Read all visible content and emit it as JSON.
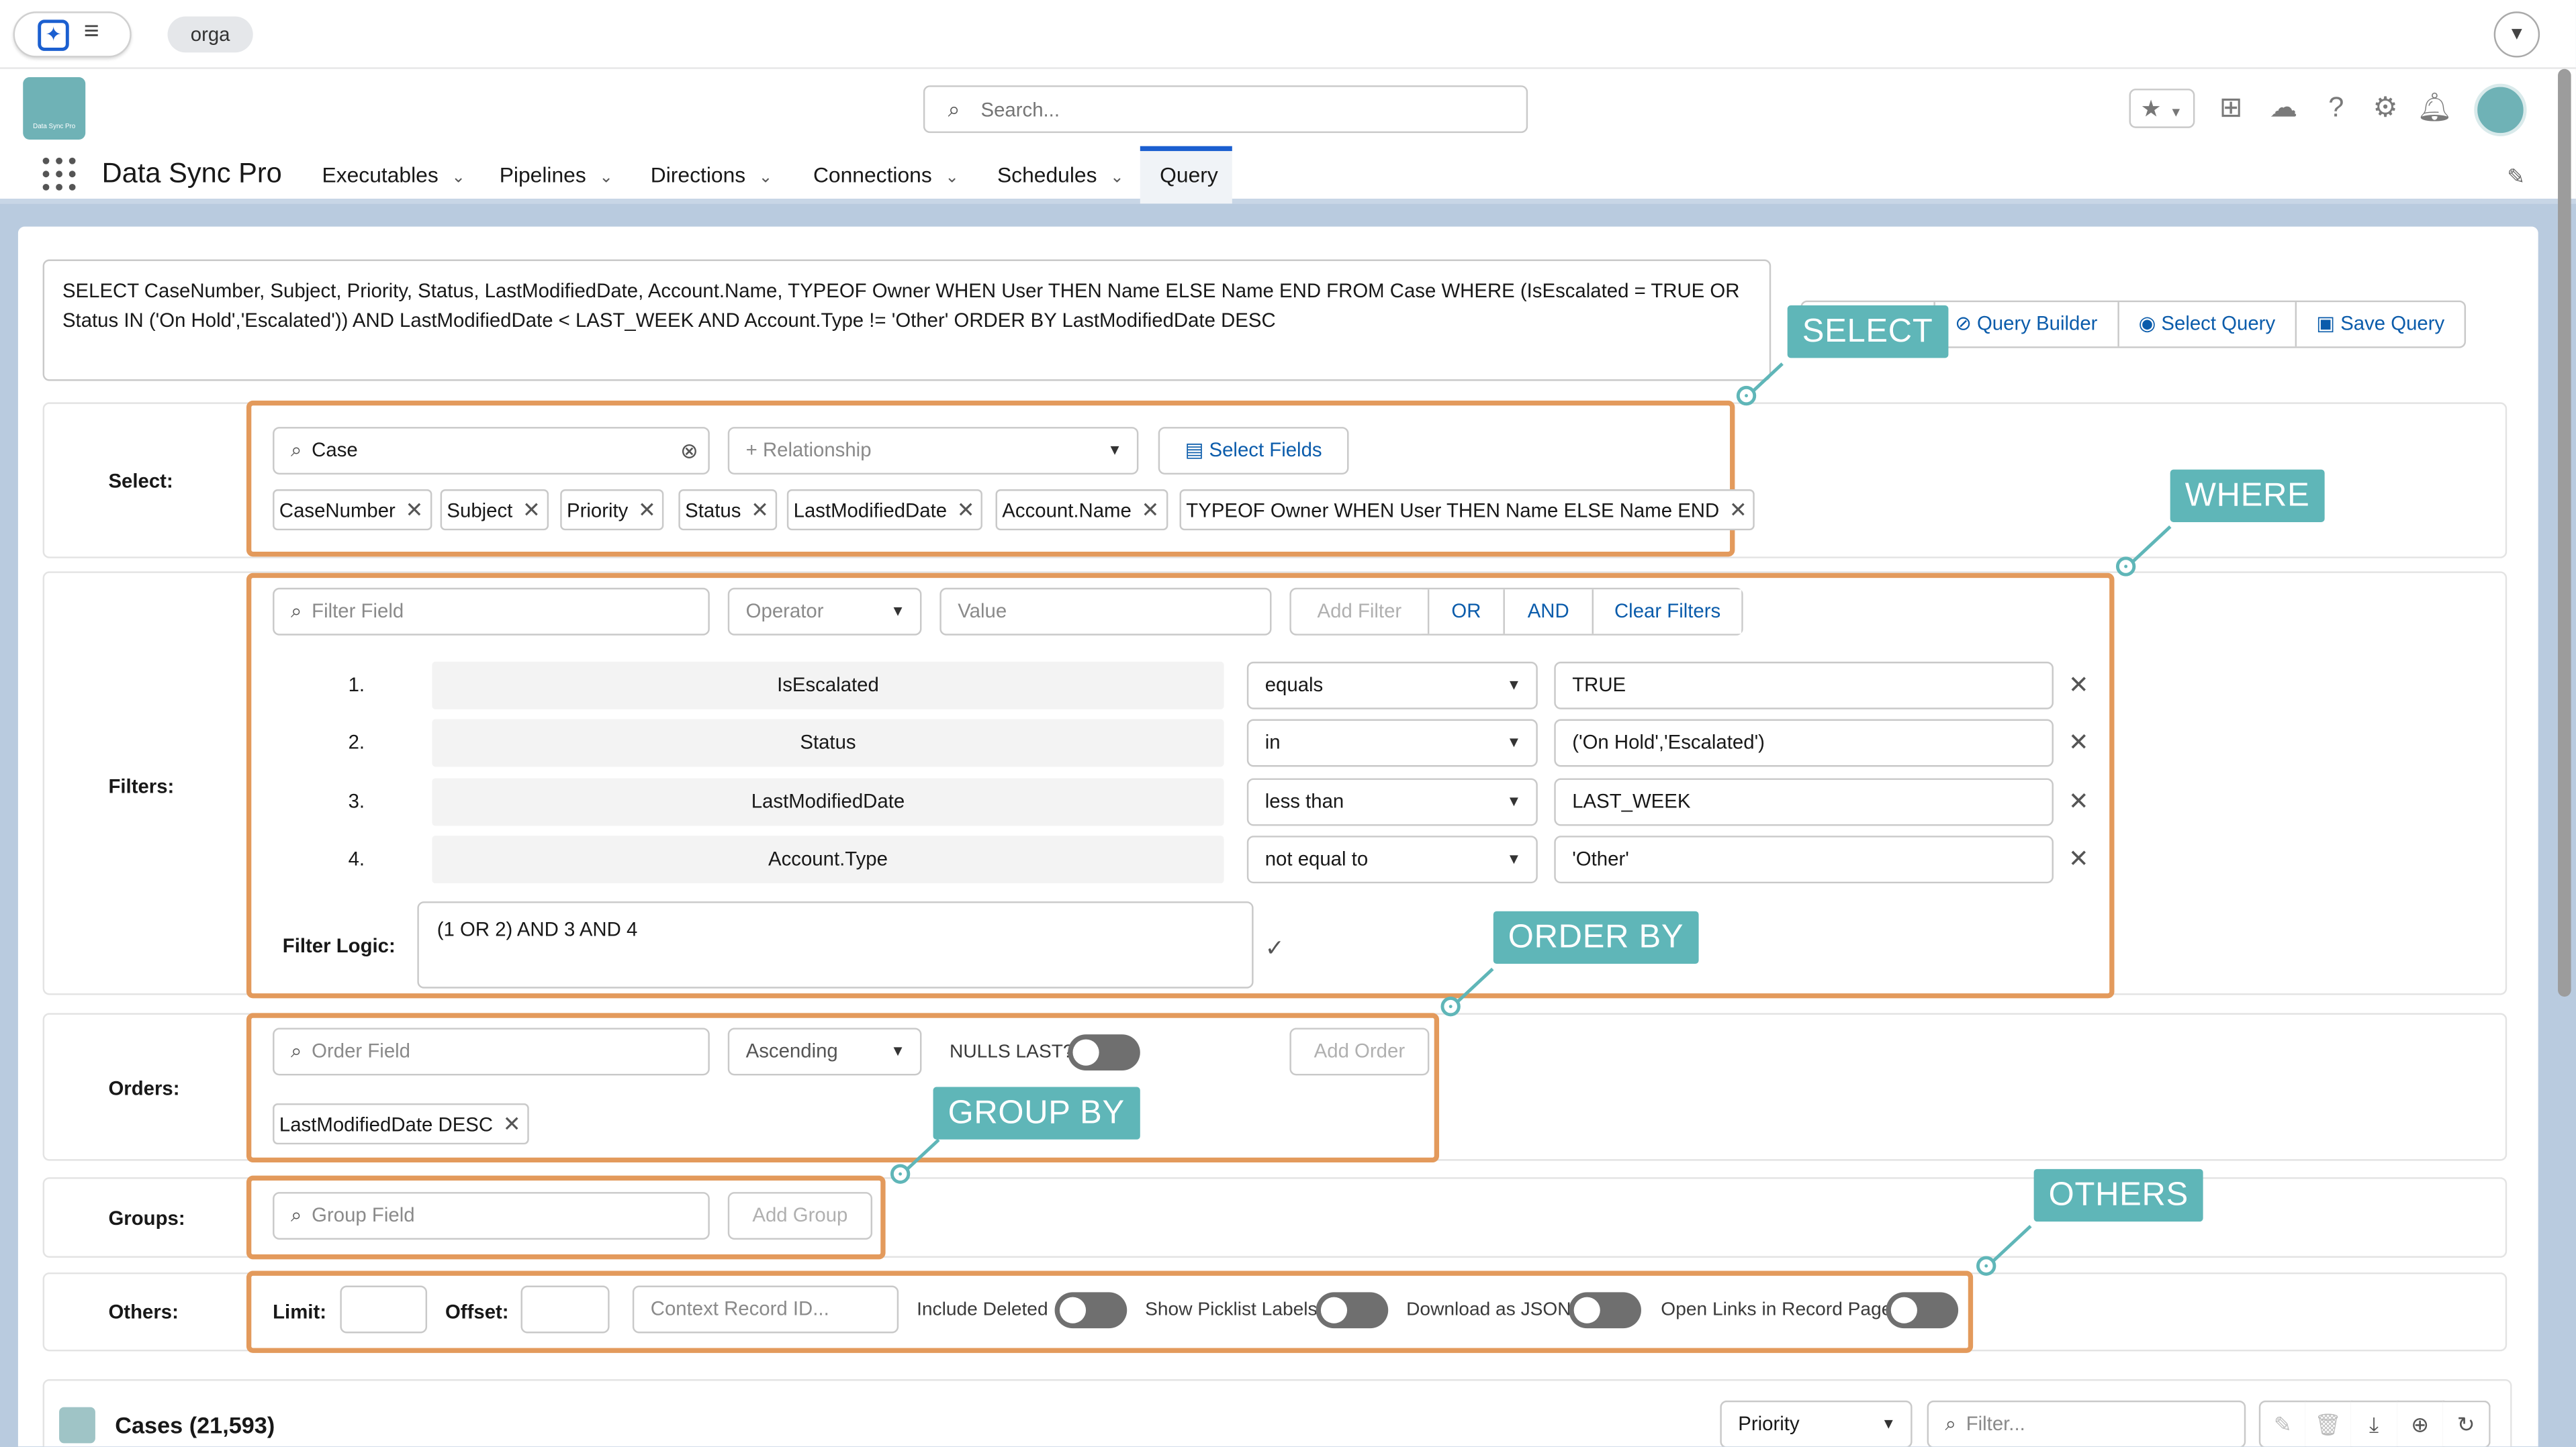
{
  "topbar": {
    "org": "orga"
  },
  "header": {
    "search_placeholder": "Search...",
    "app_name": "Data Sync Pro",
    "logo_text": "Data Sync Pro"
  },
  "nav": [
    {
      "label": "Executables"
    },
    {
      "label": "Pipelines"
    },
    {
      "label": "Directions"
    },
    {
      "label": "Connections"
    },
    {
      "label": "Schedules"
    },
    {
      "label": "Query"
    }
  ],
  "query": {
    "text": "SELECT CaseNumber, Subject, Priority, Status, LastModifiedDate, Account.Name, TYPEOF Owner WHEN User THEN Name ELSE Name END FROM Case WHERE (IsEscalated = TRUE OR Status IN ('On Hold','Escalated')) AND LastModifiedDate < LAST_WEEK AND Account.Type != 'Other' ORDER BY LastModifiedDate DESC",
    "buttons": {
      "builder": "Query Builder",
      "select": "Select Query",
      "save": "Save Query"
    }
  },
  "labels": {
    "select": "Select:",
    "filters": "Filters:",
    "orders": "Orders:",
    "groups": "Groups:",
    "others": "Others:",
    "filter_logic": "Filter Logic:",
    "limit": "Limit:",
    "offset": "Offset:"
  },
  "select": {
    "object": "Case",
    "relationship_placeholder": "+ Relationship",
    "select_fields": "Select Fields",
    "fields": [
      "CaseNumber",
      "Subject",
      "Priority",
      "Status",
      "LastModifiedDate",
      "Account.Name",
      "TYPEOF Owner WHEN User THEN Name ELSE Name END"
    ]
  },
  "filters": {
    "field_placeholder": "Filter Field",
    "operator_placeholder": "Operator",
    "value_placeholder": "Value",
    "add": "Add Filter",
    "or": "OR",
    "and": "AND",
    "clear": "Clear Filters",
    "rows": [
      {
        "num": "1.",
        "field": "IsEscalated",
        "op": "equals",
        "value": "TRUE"
      },
      {
        "num": "2.",
        "field": "Status",
        "op": "in",
        "value": "('On Hold','Escalated')"
      },
      {
        "num": "3.",
        "field": "LastModifiedDate",
        "op": "less than",
        "value": "LAST_WEEK"
      },
      {
        "num": "4.",
        "field": "Account.Type",
        "op": "not equal to",
        "value": "'Other'"
      }
    ],
    "logic": "(1 OR 2) AND 3 AND 4"
  },
  "orders": {
    "field_placeholder": "Order Field",
    "direction": "Ascending",
    "nulls_last": "NULLS LAST?",
    "add": "Add Order",
    "items": [
      "LastModifiedDate DESC"
    ]
  },
  "groups": {
    "field_placeholder": "Group Field",
    "add": "Add Group"
  },
  "others": {
    "context_placeholder": "Context Record ID...",
    "include_deleted": "Include Deleted",
    "picklist_labels": "Show Picklist Labels",
    "download_json": "Download as JSON",
    "open_links": "Open Links in Record Page"
  },
  "callouts": {
    "select": "SELECT",
    "where": "WHERE",
    "order_by": "ORDER BY",
    "group_by": "GROUP BY",
    "others": "OTHERS"
  },
  "results": {
    "title": "Cases (21,593)",
    "sort_field": "Priority",
    "filter_placeholder": "Filter..."
  },
  "colors": {
    "accent": "#0b5cab",
    "callout": "#5fb6b8",
    "highlight_border": "#e39a5c",
    "toggle_off": "#6f6f6f"
  }
}
